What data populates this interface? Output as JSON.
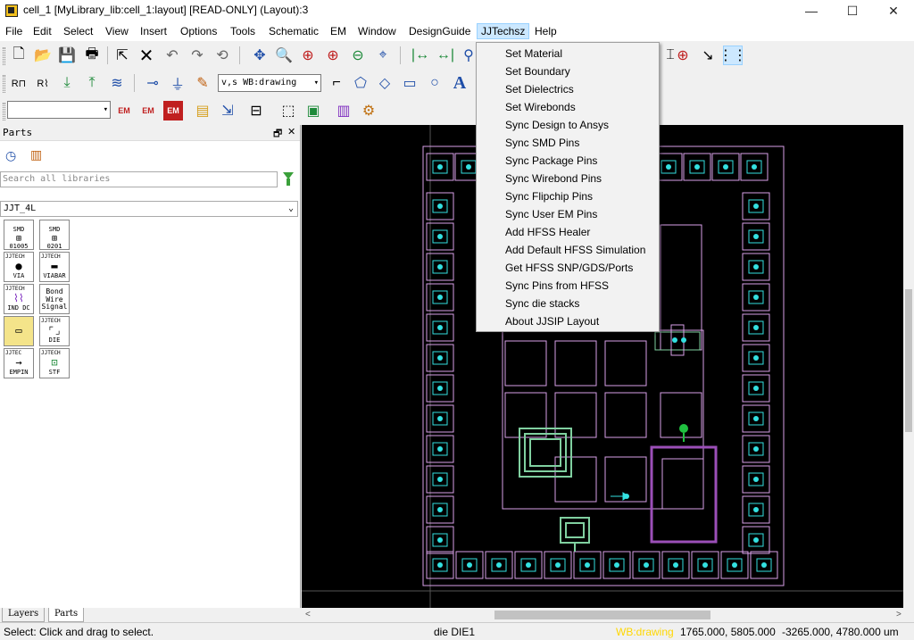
{
  "window": {
    "title": "cell_1 [MyLibrary_lib:cell_1:layout] [READ-ONLY] (Layout):3",
    "minimize": "—",
    "maximize": "☐",
    "close": "✕"
  },
  "menubar": {
    "items": [
      "File",
      "Edit",
      "Select",
      "View",
      "Insert",
      "Options",
      "Tools",
      "Schematic",
      "EM",
      "Window",
      "DesignGuide",
      "JJTechsz",
      "Help"
    ],
    "active": "JJTechsz"
  },
  "toolbar": {
    "layer_combo": "v,s WB:drawing",
    "combo_arrow": "▾",
    "em_label": "EM",
    "text_tool": "A"
  },
  "dropdown": {
    "items": [
      "Set Material",
      "Set Boundary",
      "Set Dielectrics",
      "Set Wirebonds",
      "Sync Design to Ansys",
      "Sync SMD Pins",
      "Sync Package Pins",
      "Sync Wirebond Pins",
      "Sync Flipchip Pins",
      "Sync User EM Pins",
      "Add HFSS Healer",
      "Add Default HFSS Simulation",
      "Get HFSS SNP/GDS/Ports",
      "Sync Pins from HFSS",
      "Sync die stacks",
      "About JJSIP Layout"
    ]
  },
  "parts_panel": {
    "title": "Parts",
    "float_glyph": "🗗",
    "close_glyph": "✕",
    "search_placeholder": "Search all libraries",
    "library": "JJT_4L",
    "parts": [
      {
        "tag": "",
        "glyph": "SMD",
        "label": "01005"
      },
      {
        "tag": "",
        "glyph": "SMD",
        "label": "0201"
      },
      {
        "tag": "JJTECH",
        "glyph": "●",
        "label": "VIA"
      },
      {
        "tag": "JJTECH",
        "glyph": "▬",
        "label": "VIABAR"
      },
      {
        "tag": "JJTECH",
        "glyph": "⌇⌇",
        "label": "IND DC"
      },
      {
        "tag": "",
        "glyph": "Bond Wire",
        "label": "Signal"
      },
      {
        "tag": "",
        "glyph": "▭",
        "label": ""
      },
      {
        "tag": "JJTECH",
        "glyph": "⌜⌟",
        "label": "DIE"
      },
      {
        "tag": "JJTEC",
        "glyph": "→",
        "label": "EMPIN"
      },
      {
        "tag": "JJTECH",
        "glyph": "⊡",
        "label": "STF"
      }
    ],
    "tabs": [
      "Layers",
      "Parts"
    ],
    "active_tab": "Parts"
  },
  "scrollbars": {
    "left_arrow": "<",
    "right_arrow": ">"
  },
  "status": {
    "hint": "Select: Click and drag to select.",
    "selection": "die DIE1",
    "layer": "WB:drawing",
    "coords1": "1765.000, 5805.000",
    "coords2": "-3265.000, 4780.000",
    "unit": "um"
  },
  "colors": {
    "canvas_bg": "#000000",
    "outline": "#d8a0e8",
    "pad": "#33e0e0",
    "highlight": "#9b4fb8",
    "spiral": "#80d0a0",
    "menu_active": "#cce8ff",
    "status_layer": "#ffd700"
  }
}
